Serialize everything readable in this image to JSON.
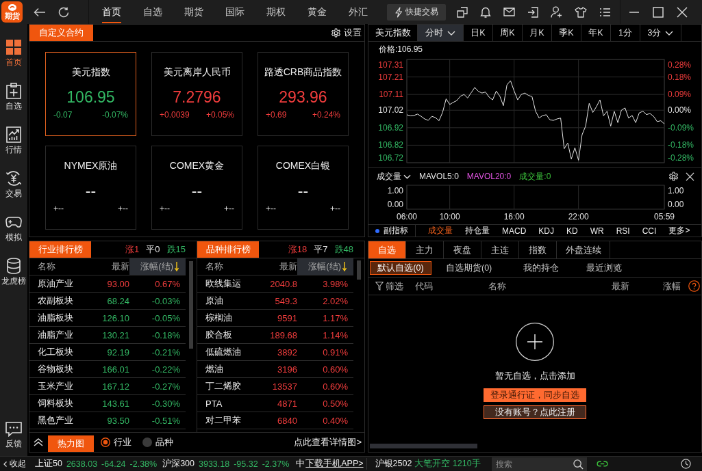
{
  "top_bar": {
    "logo": "期货",
    "nav_tabs": [
      {
        "label": "首页",
        "selected": true
      },
      {
        "label": "自选",
        "selected": false
      },
      {
        "label": "期货",
        "selected": false
      },
      {
        "label": "国际",
        "selected": false
      },
      {
        "label": "期权",
        "selected": false
      },
      {
        "label": "黄金",
        "selected": false
      },
      {
        "label": "外汇",
        "selected": false
      }
    ],
    "quick_trade": "快捷交易"
  },
  "sidebar": {
    "items": [
      {
        "label": "首页",
        "selected": true
      },
      {
        "label": "自选",
        "selected": false
      },
      {
        "label": "行情",
        "selected": false
      },
      {
        "label": "交易",
        "selected": false
      },
      {
        "label": "模拟",
        "selected": false
      },
      {
        "label": "龙虎榜",
        "selected": false
      }
    ],
    "feedback": "反馈"
  },
  "custom_contracts": {
    "tab": "自定义合约",
    "settings": "设置",
    "cards": [
      {
        "name": "美元指数",
        "value": "106.95",
        "change": "-0.07",
        "percent": "-0.07%",
        "color": "#33b864",
        "selected": true
      },
      {
        "name": "美元离岸人民币",
        "value": "7.2796",
        "change": "+0.0039",
        "percent": "+0.05%",
        "color": "#f23d3d",
        "selected": false
      },
      {
        "name": "路透CRB商品指数",
        "value": "293.96",
        "change": "+0.69",
        "percent": "+0.24%",
        "color": "#f23d3d",
        "selected": false
      },
      {
        "name": "NYMEX原油",
        "value": "--",
        "change": "+--",
        "percent": "+--",
        "color": "#e6e6e6",
        "selected": false
      },
      {
        "name": "COMEX黄金",
        "value": "--",
        "change": "+--",
        "percent": "+--",
        "color": "#e6e6e6",
        "selected": false
      },
      {
        "name": "COMEX白银",
        "value": "--",
        "change": "+--",
        "percent": "+--",
        "color": "#e6e6e6",
        "selected": false
      }
    ]
  },
  "chart_panel": {
    "symbol": "美元指数",
    "periods": [
      {
        "label": "分时",
        "selected": true,
        "dropdown": true
      },
      {
        "label": "日K",
        "selected": false,
        "dropdown": false
      },
      {
        "label": "周K",
        "selected": false,
        "dropdown": false
      },
      {
        "label": "月K",
        "selected": false,
        "dropdown": false
      },
      {
        "label": "季K",
        "selected": false,
        "dropdown": false
      },
      {
        "label": "年K",
        "selected": false,
        "dropdown": false
      },
      {
        "label": "1分",
        "selected": false,
        "dropdown": false
      },
      {
        "label": "3分",
        "selected": false,
        "dropdown": true
      }
    ],
    "price_label": "价格:106.95",
    "price_chart": {
      "chart_data": {
        "type": "line",
        "grid": true,
        "categories": [
          "06:00",
          null,
          null,
          null,
          null,
          null,
          null,
          null,
          null,
          null,
          null,
          null,
          "10:00",
          null,
          null,
          null,
          null,
          null,
          null,
          null,
          null,
          null,
          null,
          null,
          null,
          null,
          null,
          null,
          null,
          null,
          "16:00",
          null,
          null,
          null,
          null,
          null,
          null,
          null,
          null,
          null,
          null,
          null,
          null,
          null,
          null,
          null,
          null,
          null,
          "22:00",
          null,
          null,
          null,
          null,
          null,
          null,
          null,
          null,
          null,
          null,
          null,
          null,
          null,
          null,
          null,
          null,
          null,
          null,
          null,
          null,
          null,
          null,
          null,
          "05:59"
        ],
        "values": [
          106.994,
          106.988,
          106.99,
          106.998,
          106.985,
          106.97,
          106.962,
          106.985,
          106.978,
          106.96,
          107.007,
          107.085,
          107.053,
          107.065,
          107.075,
          107.1,
          107.11,
          107.09,
          107.12,
          107.15,
          107.128,
          107.118,
          107.124,
          107.095,
          107.079,
          107.13,
          107.1,
          107.046,
          107.165,
          107.189,
          107.13,
          107.079,
          107.11,
          107.118,
          107.105,
          107.098,
          107.014,
          106.975,
          106.99,
          106.994,
          106.965,
          106.962,
          106.97,
          106.975,
          106.8,
          106.832,
          106.741,
          106.806,
          106.734,
          106.88,
          106.93,
          107.059,
          107.007,
          107.04,
          107.079,
          106.988,
          107.014,
          106.929,
          107.014,
          106.949,
          107.02,
          107.033,
          106.975,
          106.99,
          106.949,
          107.005,
          107.014,
          106.995,
          107.001,
          106.985,
          106.955,
          106.96,
          106.942
        ],
        "ylim": [
          106.72,
          107.31
        ],
        "yticks": [
          107.31,
          107.21,
          107.11,
          107.02,
          106.92,
          106.82,
          106.72
        ]
      },
      "percent_labels": [
        {
          "text": "0.28%",
          "color": "#f23d3d"
        },
        {
          "text": "0.18%",
          "color": "#f23d3d"
        },
        {
          "text": "0.09%",
          "color": "#f23d3d"
        },
        {
          "text": "0.00%",
          "color": "#e6e6e6"
        },
        {
          "text": "-0.09%",
          "color": "#33b864"
        },
        {
          "text": "-0.18%",
          "color": "#33b864"
        },
        {
          "text": "-0.28%",
          "color": "#33b864"
        }
      ]
    },
    "volume": {
      "selector": "成交量",
      "indicators": [
        {
          "text": "MAVOL5:0",
          "color": "#e6e6e6"
        },
        {
          "text": "MAVOL20:0",
          "color": "#e455e4"
        },
        {
          "text": "成交量:0",
          "color": "#3cc43c"
        }
      ],
      "left_ticks": [
        "1.00",
        "0.00"
      ],
      "right_ticks": [
        "1.00",
        "0.00"
      ]
    },
    "indicator_tabs": {
      "label": "副指标",
      "tabs": [
        {
          "label": "成交量",
          "selected": true
        },
        {
          "label": "持仓量",
          "selected": false
        },
        {
          "label": "MACD",
          "selected": false
        },
        {
          "label": "KDJ",
          "selected": false
        },
        {
          "label": "KD",
          "selected": false
        },
        {
          "label": "WR",
          "selected": false
        },
        {
          "label": "RSI",
          "selected": false
        },
        {
          "label": "CCI",
          "selected": false
        },
        {
          "label": "更多>",
          "selected": false
        }
      ]
    }
  },
  "rankings": [
    {
      "title": "行业排行榜",
      "counts": [
        {
          "text": "涨1",
          "color": "#f23d3d"
        },
        {
          "text": "平0",
          "color": "#e6e6e6"
        },
        {
          "text": "跌15",
          "color": "#33b864"
        }
      ],
      "columns": [
        {
          "label": "名称",
          "sorted": false
        },
        {
          "label": "最新",
          "sorted": false
        },
        {
          "label": "涨幅(结)",
          "sorted": true
        }
      ],
      "rows": [
        {
          "name": "原油产业",
          "price": "93.00",
          "percent": "0.67%",
          "color": "#f23d3d"
        },
        {
          "name": "农副板块",
          "price": "68.24",
          "percent": "-0.03%",
          "color": "#33b864"
        },
        {
          "name": "油脂板块",
          "price": "126.10",
          "percent": "-0.05%",
          "color": "#33b864"
        },
        {
          "name": "油脂产业",
          "price": "130.21",
          "percent": "-0.18%",
          "color": "#33b864"
        },
        {
          "name": "化工板块",
          "price": "92.19",
          "percent": "-0.21%",
          "color": "#33b864"
        },
        {
          "name": "谷物板块",
          "price": "166.01",
          "percent": "-0.22%",
          "color": "#33b864"
        },
        {
          "name": "玉米产业",
          "price": "167.12",
          "percent": "-0.27%",
          "color": "#33b864"
        },
        {
          "name": "饲料板块",
          "price": "143.61",
          "percent": "-0.30%",
          "color": "#33b864"
        },
        {
          "name": "黑色产业",
          "price": "93.50",
          "percent": "-0.51%",
          "color": "#33b864"
        }
      ]
    },
    {
      "title": "品种排行榜",
      "counts": [
        {
          "text": "涨18",
          "color": "#f23d3d"
        },
        {
          "text": "平7",
          "color": "#e6e6e6"
        },
        {
          "text": "跌48",
          "color": "#33b864"
        }
      ],
      "columns": [
        {
          "label": "名称",
          "sorted": false
        },
        {
          "label": "最新",
          "sorted": false
        },
        {
          "label": "涨幅(结)",
          "sorted": true
        }
      ],
      "rows": [
        {
          "name": "欧线集运",
          "price": "2040.8",
          "percent": "3.98%",
          "color": "#f23d3d"
        },
        {
          "name": "原油",
          "price": "549.3",
          "percent": "2.02%",
          "color": "#f23d3d"
        },
        {
          "name": "棕榈油",
          "price": "9591",
          "percent": "1.17%",
          "color": "#f23d3d"
        },
        {
          "name": "胶合板",
          "price": "189.68",
          "percent": "1.14%",
          "color": "#f23d3d"
        },
        {
          "name": "低硫燃油",
          "price": "3892",
          "percent": "0.91%",
          "color": "#f23d3d"
        },
        {
          "name": "燃油",
          "price": "3196",
          "percent": "0.60%",
          "color": "#f23d3d"
        },
        {
          "name": "丁二烯胶",
          "price": "13537",
          "percent": "0.60%",
          "color": "#f23d3d"
        },
        {
          "name": "PTA",
          "price": "4871",
          "percent": "0.50%",
          "color": "#f23d3d"
        },
        {
          "name": "对二甲苯",
          "price": "6840",
          "percent": "0.40%",
          "color": "#f23d3d"
        }
      ]
    }
  ],
  "heatmap_bar": {
    "button": "热力图",
    "options": [
      {
        "label": "行业",
        "selected": true
      },
      {
        "label": "品种",
        "selected": false
      }
    ],
    "link": "点此查看详情图>"
  },
  "watchlist": {
    "tabs": [
      {
        "label": "自选",
        "selected": true
      },
      {
        "label": "主力",
        "selected": false
      },
      {
        "label": "夜盘",
        "selected": false
      },
      {
        "label": "主连",
        "selected": false
      },
      {
        "label": "指数",
        "selected": false
      },
      {
        "label": "外盘连续",
        "selected": false
      }
    ],
    "sub_tabs": [
      {
        "label": "默认自选(0)",
        "selected": true
      },
      {
        "label": "自选期货(0)",
        "selected": false
      },
      {
        "label": "我的持仓",
        "selected": false
      },
      {
        "label": "最近浏览",
        "selected": false
      }
    ],
    "filter": "筛选",
    "columns": [
      "代码",
      "名称",
      "最新",
      "涨幅"
    ],
    "empty_message": "暂无自选，点击添加",
    "login_button": "登录通行证，同步自选",
    "register_button": "没有账号？点此注册"
  },
  "status_bar": {
    "collapse": "收起",
    "tickers": [
      {
        "name": "上证50",
        "price": "2638.03",
        "change": "-64.24",
        "percent": "-2.38%",
        "color": "#33b864"
      },
      {
        "name": "沪深300",
        "price": "3933.18",
        "change": "-95.32",
        "percent": "-2.37%",
        "color": "#33b864"
      }
    ],
    "cut_ticker": "中",
    "download_link": "下载手机APP>",
    "alert": {
      "symbol": "沪银2502",
      "message": "大笔开空 1210手",
      "color": "#33b864"
    },
    "search": {
      "placeholder": "搜索"
    }
  }
}
